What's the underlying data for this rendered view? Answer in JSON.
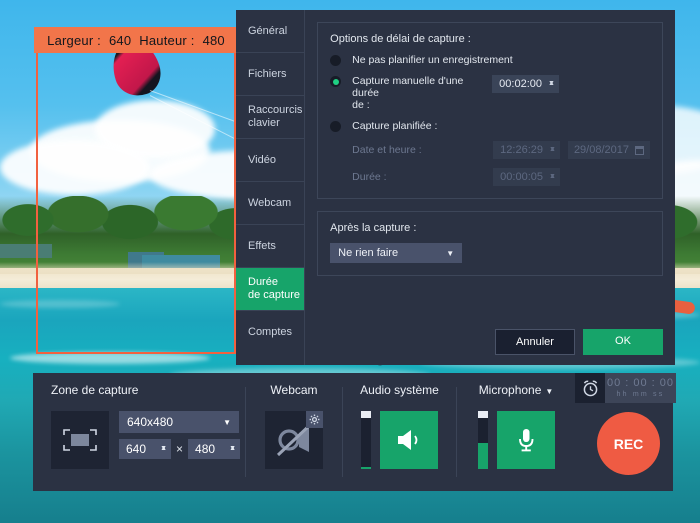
{
  "capture_overlay": {
    "width_label": "Largeur :",
    "width_value": "640",
    "height_label": "Hauteur :",
    "height_value": "480",
    "frame_color": "#f2613f",
    "label_bg": "#f2754a"
  },
  "dialog": {
    "tabs": [
      {
        "label": "Général",
        "active": false
      },
      {
        "label": "Fichiers",
        "active": false
      },
      {
        "label": "Raccourcis clavier",
        "active": false
      },
      {
        "label": "Vidéo",
        "active": false
      },
      {
        "label": "Webcam",
        "active": false
      },
      {
        "label": "Effets",
        "active": false
      },
      {
        "label": "Durée de capture",
        "active": true
      },
      {
        "label": "Comptes",
        "active": false
      }
    ],
    "tab_labels": {
      "general": "Général",
      "fichiers": "Fichiers",
      "raccourcis_l1": "Raccourcis",
      "raccourcis_l2": "clavier",
      "video": "Vidéo",
      "webcam": "Webcam",
      "effets": "Effets",
      "duree_l1": "Durée",
      "duree_l2": "de capture",
      "comptes": "Comptes"
    },
    "delay_group": {
      "title": "Options de délai de capture :",
      "option_none": "Ne pas planifier un enregistrement",
      "option_manual": "Capture manuelle d'une durée de :",
      "option_manual_l1": "Capture manuelle d'une durée",
      "option_manual_l2": "de :",
      "manual_duration": "00:02:00",
      "option_scheduled": "Capture planifiée :",
      "datetime_label": "Date et heure :",
      "datetime_time": "12:26:29",
      "datetime_date": "29/08/2017",
      "duration_label": "Durée :",
      "duration_value": "00:00:05",
      "selected": "manual"
    },
    "after_group": {
      "title": "Après la capture :",
      "selected_action": "Ne rien faire"
    },
    "buttons": {
      "cancel": "Annuler",
      "ok": "OK"
    },
    "accent_color": "#17a46a"
  },
  "bottom_bar": {
    "capture_zone": {
      "title": "Zone de capture",
      "preset": "640x480",
      "width": "640",
      "separator": "×",
      "height": "480"
    },
    "webcam": {
      "title": "Webcam",
      "state": "disabled"
    },
    "system_audio": {
      "title": "Audio système",
      "state": "enabled",
      "level_percent": 4
    },
    "microphone": {
      "title": "Microphone",
      "state": "enabled",
      "level_percent": 45
    },
    "timer": {
      "value": "00 : 00 : 00",
      "units": "hh   mm   ss"
    },
    "record_button": "REC"
  }
}
